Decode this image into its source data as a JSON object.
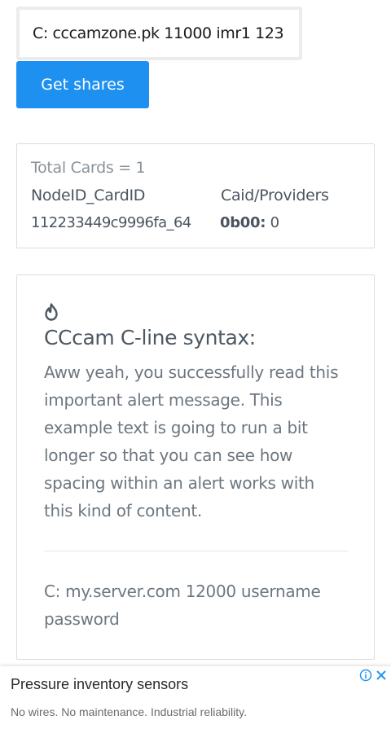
{
  "form": {
    "cline_value": "C: cccamzone.pk 11000 imr1 123",
    "get_shares_label": "Get shares"
  },
  "cards": {
    "total_label": "Total Cards = 1",
    "col_node": "NodeID_CardID",
    "col_caid": "Caid/Providers",
    "rows": [
      {
        "node": "112233449c9996fa_64",
        "caid": "0b00:",
        "providers": " 0"
      }
    ]
  },
  "alert": {
    "icon": "flame-icon",
    "title": "CCcam C-line syntax:",
    "body": "Aww yeah, you successfully read this important alert message. This example text is going to run a bit longer so that you can see how spacing within an alert works with this kind of content.",
    "footer": "C: my.server.com 12000 username password"
  },
  "ad": {
    "title": "Pressure inventory sensors",
    "description": "No wires. No maintenance. Industrial reliability.",
    "info_icon": "info-icon",
    "close_icon": "close-icon"
  },
  "colors": {
    "button": "#1e90f0",
    "ad_icon": "#2196f3"
  }
}
